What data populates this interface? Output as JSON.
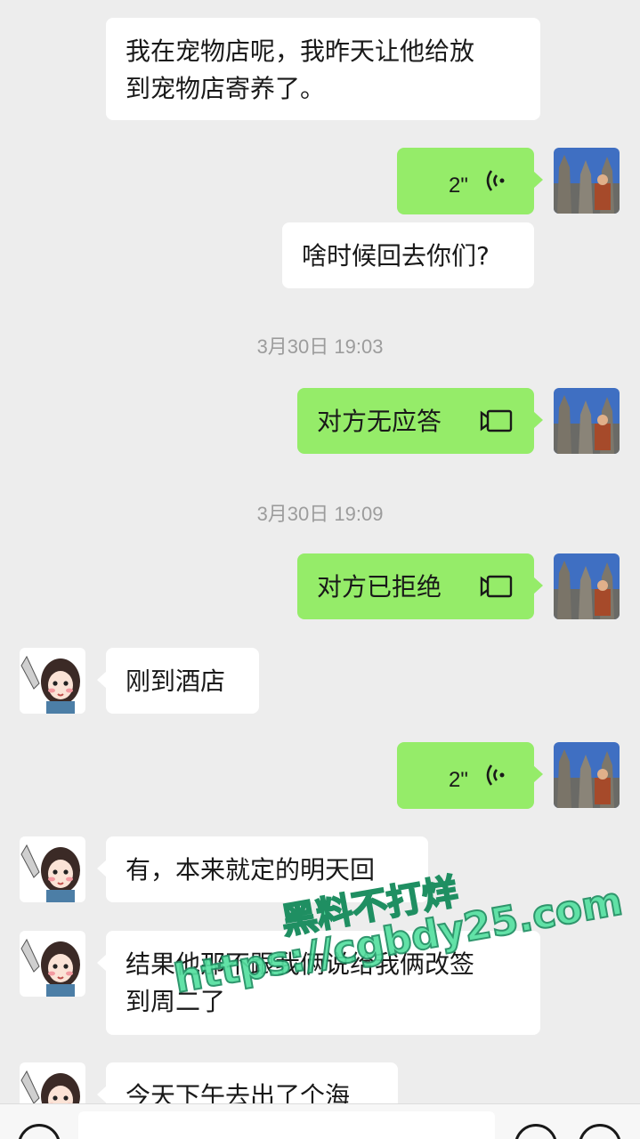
{
  "messages": [
    {
      "side": "in",
      "text_lines": [
        "我在宠物店呢，我昨天让他给放",
        "到宠物店寄养了。"
      ]
    },
    {
      "side": "out",
      "type": "voice",
      "duration": "2\""
    },
    {
      "side": "out",
      "text": "啥时候回去你们?"
    },
    {
      "type": "time",
      "text": "3月30日 19:03"
    },
    {
      "side": "out",
      "type": "call",
      "text": "对方无应答"
    },
    {
      "type": "time",
      "text": "3月30日 19:09"
    },
    {
      "side": "out",
      "type": "call",
      "text": "对方已拒绝"
    },
    {
      "side": "in",
      "text": "刚到酒店"
    },
    {
      "side": "out",
      "type": "voice",
      "duration": "2\""
    },
    {
      "side": "in",
      "text": "有，本来就定的明天回"
    },
    {
      "side": "in",
      "text_lines": [
        "结果他那不跟我俩说给我俩改签",
        "到周二了"
      ]
    },
    {
      "side": "in",
      "text": "今天下午去出了个海"
    }
  ],
  "watermark": {
    "line1": "黑料不打烊",
    "line2": "https://cgbdy25.com"
  },
  "icons": {
    "voice": "voice-wave-icon",
    "call": "video-call-icon",
    "mic": "voice-input-icon",
    "emoji": "emoji-icon",
    "plus": "plus-icon"
  },
  "colors": {
    "background": "#ededed",
    "outgoing": "#95ec69",
    "incoming": "#ffffff"
  }
}
